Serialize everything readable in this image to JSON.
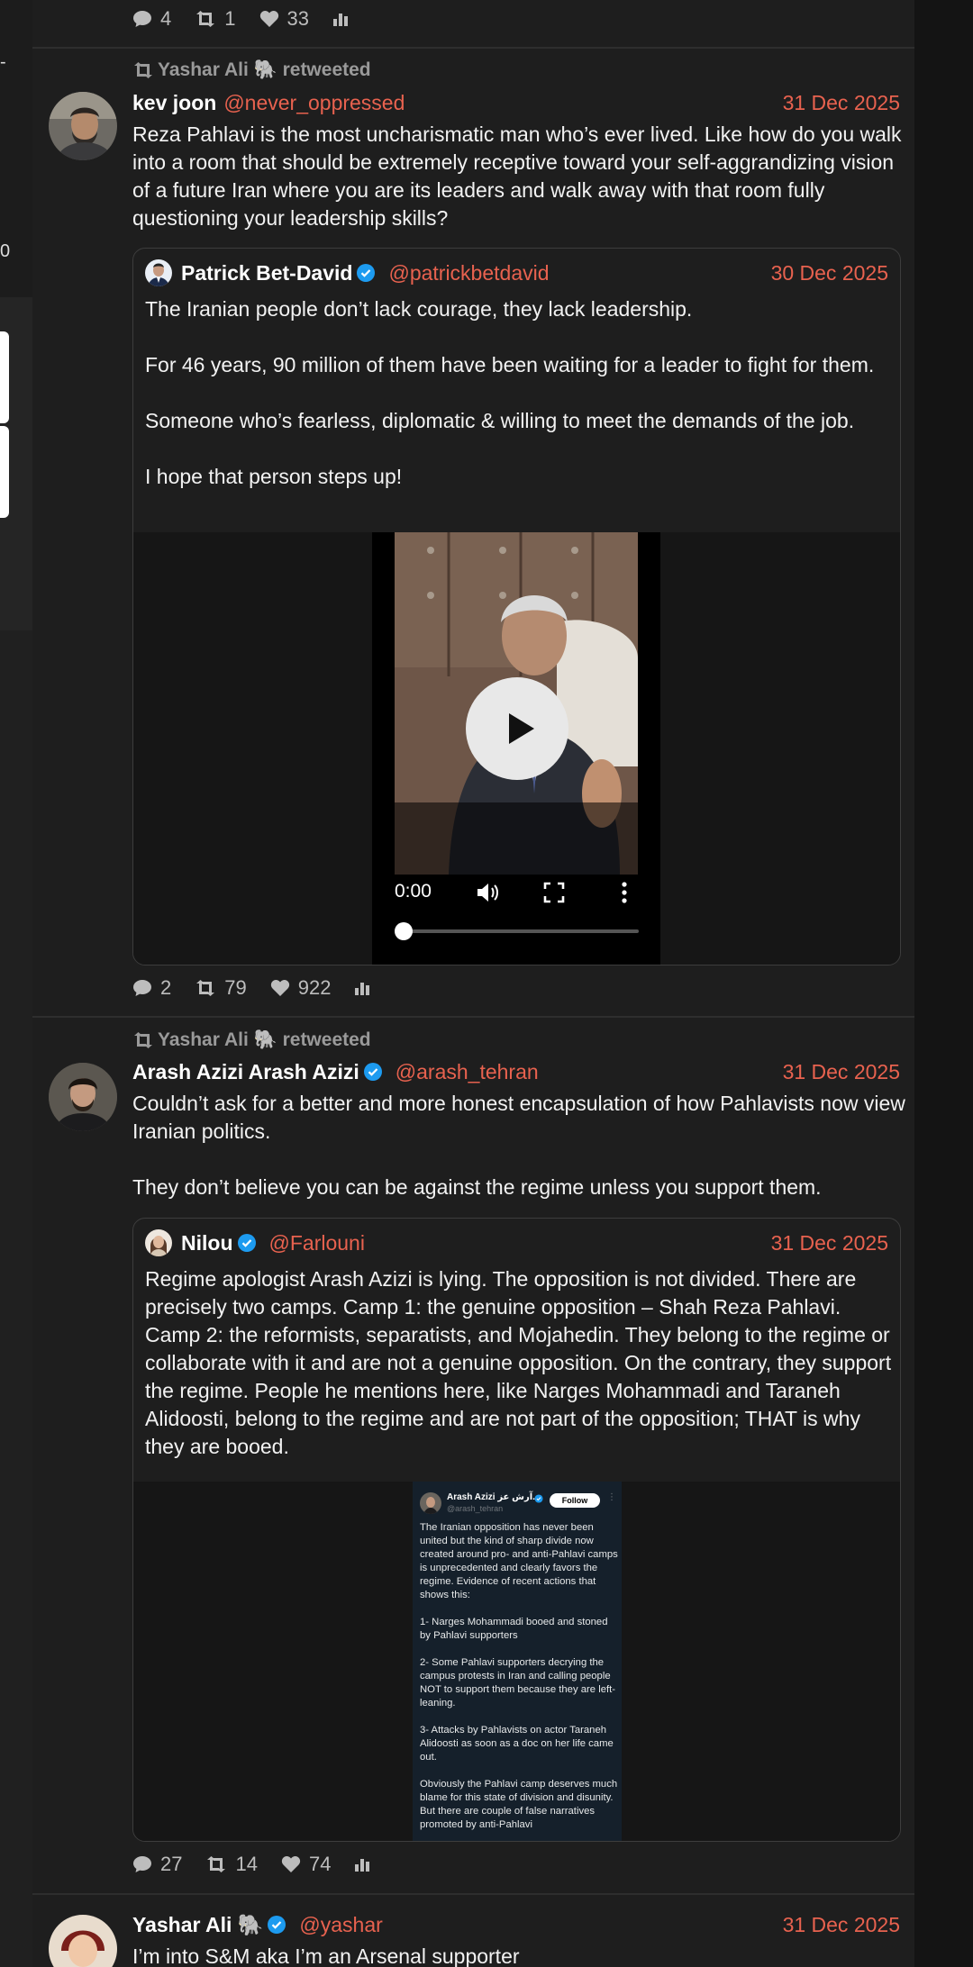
{
  "left_panel": {
    "top_mark": "-",
    "mid_mark": "0"
  },
  "posts": [
    {
      "stats": {
        "replies": "4",
        "retweets": "1",
        "likes": "33"
      }
    },
    {
      "retweeted_by": "Yashar Ali 🐘 retweeted",
      "author": {
        "name": "kev joon",
        "handle": "@never_oppressed",
        "verified": false
      },
      "date": "31 Dec 2025",
      "text": "Reza Pahlavi is the most uncharismatic man who’s ever lived. Like how do you walk into a room that should be extremely receptive toward your self-aggrandizing vision of a future Iran where you are its leaders and walk away with that room fully questioning your leadership skills?",
      "quote": {
        "author": {
          "name": "Patrick Bet-David",
          "handle": "@patrickbetdavid",
          "verified": true
        },
        "date": "30 Dec 2025",
        "text": "The Iranian people don’t lack courage, they lack leadership.\n\nFor 46 years, 90 million of them have been waiting for a leader to fight for them.\n\nSomeone who’s fearless, diplomatic & willing to meet the demands of the job.\n\nI hope that person steps up!",
        "video": {
          "time": "0:00",
          "progress": 0
        }
      },
      "stats": {
        "replies": "2",
        "retweets": "79",
        "likes": "922"
      }
    },
    {
      "retweeted_by": "Yashar Ali 🐘 retweeted",
      "author": {
        "name": "Arash Azizi Arash Azizi",
        "handle": "@arash_tehran",
        "verified": true
      },
      "date": "31 Dec 2025",
      "text": "Couldn’t ask for a better and more honest  encapsulation of how Pahlavists now view Iranian politics.\n\nThey don’t believe you can be against the regime unless you support them.",
      "quote": {
        "author": {
          "name": "Nilou",
          "handle": "@Farlouni",
          "verified": true
        },
        "date": "31 Dec 2025",
        "text": "Regime apologist Arash Azizi is lying. The opposition is not divided. There are precisely two camps. Camp 1: the genuine opposition – Shah Reza Pahlavi. Camp 2: the reformists, separatists, and Mojahedin. They belong to the regime or collaborate with it and are not a genuine opposition. On the contrary, they support the regime. People he mentions here, like Narges Mohammadi and Taraneh Alidoosti, belong to the regime and are not part of the opposition; THAT is why they are booed.",
        "embedded_screenshot": {
          "name": "Arash Azizi آرش عز...",
          "handle": "@arash_tehran",
          "follow_label": "Follow",
          "text": "The Iranian opposition has never been united but the kind of sharp divide now created around pro- and anti-Pahlavi camps is unprecedented and clearly favors the regime. Evidence of recent actions that shows this:\n\n1- Narges Mohammadi booed and stoned by Pahlavi supporters\n\n2- Some Pahlavi supporters decrying the campus protests in Iran and calling people NOT to support them because they are left-leaning.\n\n3- Attacks by Pahlavists on actor Taraneh Alidoosti as soon as a doc on her life came out.\n\nObviously the Pahlavi camp deserves much blame for this state of division and disunity. But there are couple of false narratives promoted by anti-Pahlavi"
        }
      },
      "stats": {
        "replies": "27",
        "retweets": "14",
        "likes": "74"
      }
    },
    {
      "author": {
        "name": "Yashar Ali 🐘",
        "handle": "@yashar",
        "verified": true
      },
      "date": "31 Dec 2025",
      "text": "I’m into S&M aka I’m an Arsenal supporter"
    }
  ],
  "colors": {
    "accent": "#e8624f",
    "background": "#1e1e1e",
    "verified": "#1d9bf0"
  }
}
